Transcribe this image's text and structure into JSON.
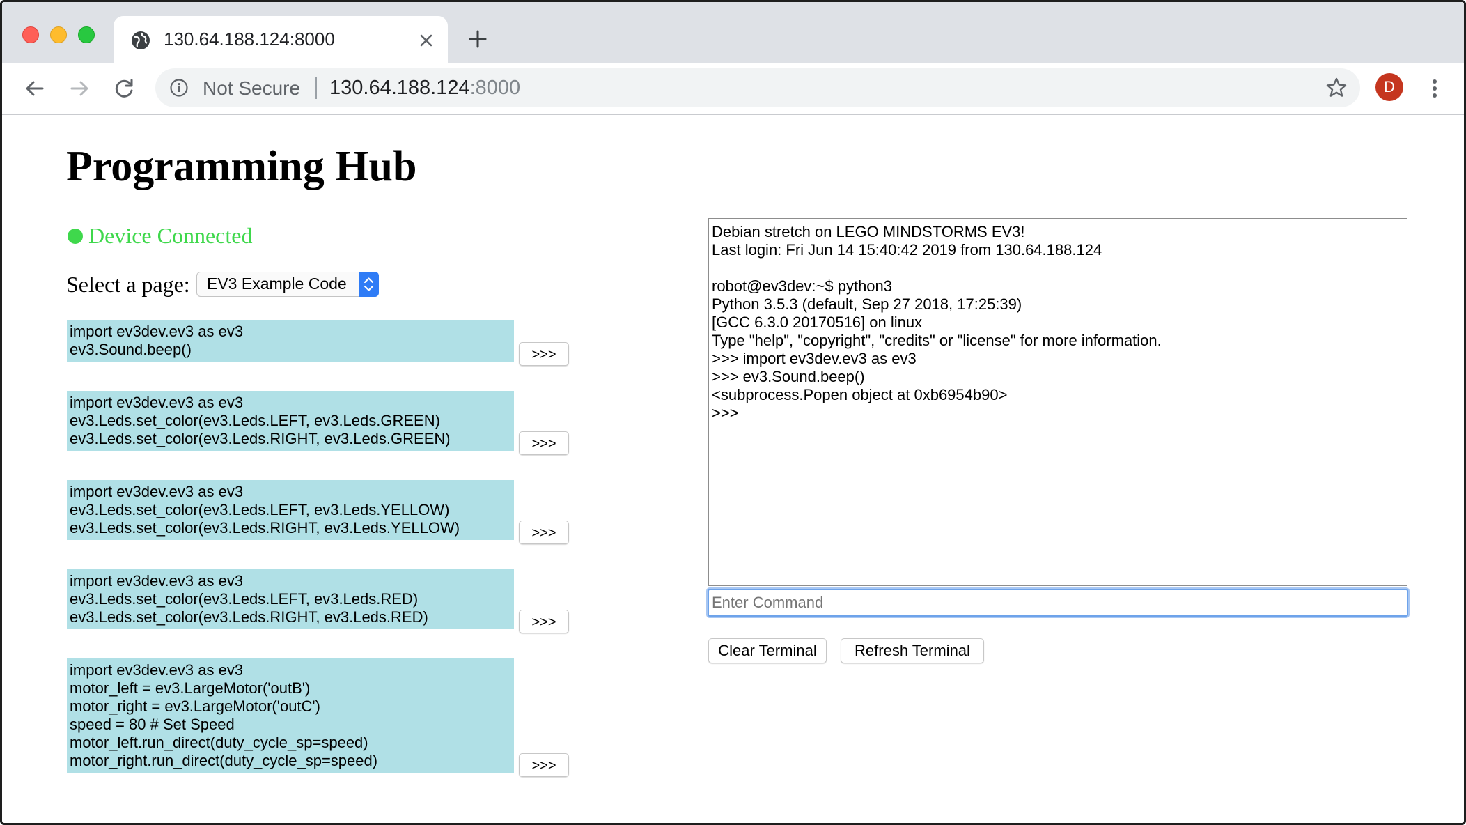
{
  "browser": {
    "tab_title": "130.64.188.124:8000",
    "security_label": "Not Secure",
    "url_host": "130.64.188.124",
    "url_port": ":8000",
    "profile_initial": "D"
  },
  "page": {
    "title": "Programming Hub",
    "status_text": "Device Connected",
    "status_color": "#3fd84c",
    "select_label": "Select a page:",
    "select_value": "EV3 Example Code",
    "code_blocks": [
      {
        "lines": [
          "import ev3dev.ev3 as ev3",
          "ev3.Sound.beep()"
        ],
        "run_label": ">>>"
      },
      {
        "lines": [
          "import ev3dev.ev3 as ev3",
          "ev3.Leds.set_color(ev3.Leds.LEFT, ev3.Leds.GREEN)",
          "ev3.Leds.set_color(ev3.Leds.RIGHT, ev3.Leds.GREEN)"
        ],
        "run_label": ">>>"
      },
      {
        "lines": [
          "import ev3dev.ev3 as ev3",
          "ev3.Leds.set_color(ev3.Leds.LEFT, ev3.Leds.YELLOW)",
          "ev3.Leds.set_color(ev3.Leds.RIGHT, ev3.Leds.YELLOW)"
        ],
        "run_label": ">>>"
      },
      {
        "lines": [
          "import ev3dev.ev3 as ev3",
          "ev3.Leds.set_color(ev3.Leds.LEFT, ev3.Leds.RED)",
          "ev3.Leds.set_color(ev3.Leds.RIGHT, ev3.Leds.RED)"
        ],
        "run_label": ">>>"
      },
      {
        "lines": [
          "import ev3dev.ev3 as ev3",
          "motor_left = ev3.LargeMotor('outB')",
          "motor_right = ev3.LargeMotor('outC')",
          "speed = 80 # Set Speed",
          "motor_left.run_direct(duty_cycle_sp=speed)",
          "motor_right.run_direct(duty_cycle_sp=speed)"
        ],
        "run_label": ">>>"
      }
    ],
    "code_block_color": "#b0e0e6"
  },
  "terminal": {
    "lines": [
      "Debian stretch on LEGO MINDSTORMS EV3!",
      "Last login: Fri Jun 14 15:40:42 2019 from 130.64.188.124",
      "",
      "robot@ev3dev:~$ python3",
      "Python 3.5.3 (default, Sep 27 2018, 17:25:39)",
      "[GCC 6.3.0 20170516] on linux",
      "Type \"help\", \"copyright\", \"credits\" or \"license\" for more information.",
      ">>> import ev3dev.ev3 as ev3",
      ">>> ev3.Sound.beep()",
      "<subprocess.Popen object at 0xb6954b90>",
      ">>>"
    ],
    "command_placeholder": "Enter Command",
    "clear_label": "Clear Terminal",
    "refresh_label": "Refresh Terminal"
  }
}
